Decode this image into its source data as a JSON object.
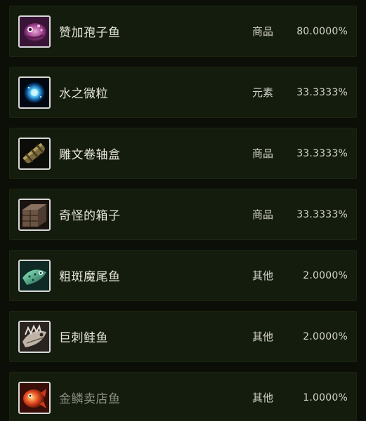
{
  "items": [
    {
      "name": "赞加孢子鱼",
      "type": "商品",
      "chance": "80.0000%",
      "icon": "spore-fish-icon"
    },
    {
      "name": "水之微粒",
      "type": "元素",
      "chance": "33.3333%",
      "icon": "water-mote-icon"
    },
    {
      "name": "雕文卷轴盒",
      "type": "商品",
      "chance": "33.3333%",
      "icon": "scroll-case-icon"
    },
    {
      "name": "奇怪的箱子",
      "type": "商品",
      "chance": "33.3333%",
      "icon": "wooden-crate-icon"
    },
    {
      "name": "粗斑魔尾鱼",
      "type": "其他",
      "chance": "2.0000%",
      "icon": "spotted-fish-icon"
    },
    {
      "name": "巨刺鲑鱼",
      "type": "其他",
      "chance": "2.0000%",
      "icon": "spiny-salmon-icon"
    },
    {
      "name": "金鳞卖店鱼",
      "type": "其他",
      "chance": "1.0000%",
      "icon": "golden-fish-icon"
    }
  ],
  "colors": {
    "background": "#0b0f07",
    "row_background": "#141c0d",
    "icon_border": "#d9d9d9",
    "text": "#e6e6dc",
    "text_dim": "#8f9288"
  }
}
